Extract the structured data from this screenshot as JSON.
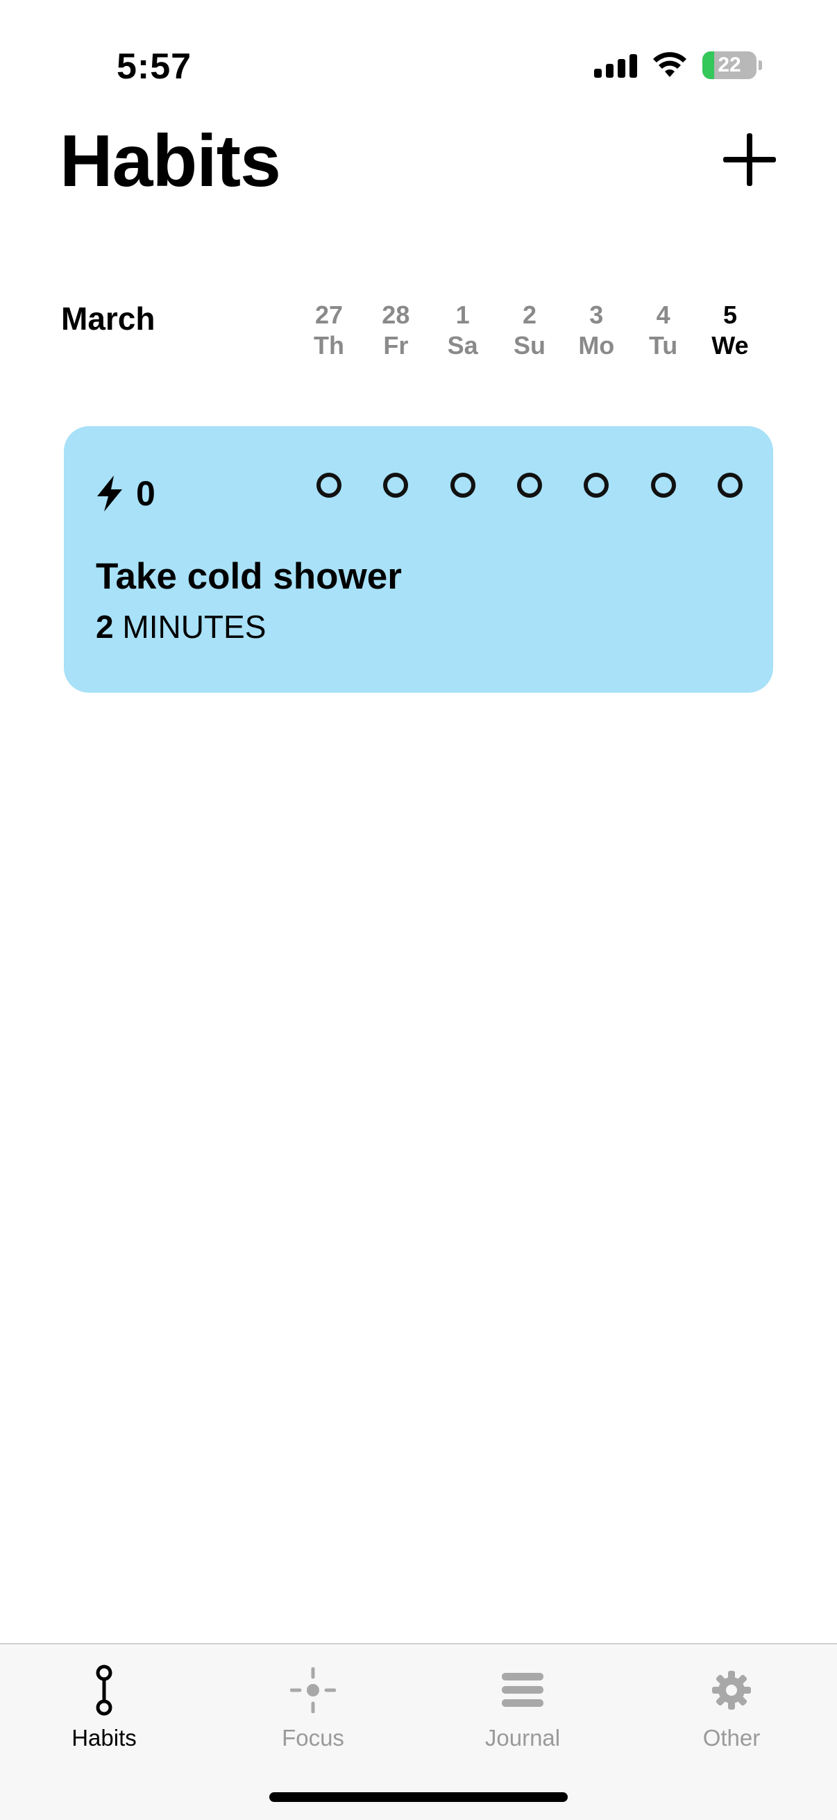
{
  "status_bar": {
    "time": "5:57",
    "battery_text": "22",
    "battery_level_percent": 22,
    "icons": [
      "cellular-signal-icon",
      "wifi-icon",
      "battery-charging-icon"
    ]
  },
  "header": {
    "title": "Habits",
    "add_icon": "plus-icon"
  },
  "calendar": {
    "month": "March",
    "days": [
      {
        "date": "27",
        "weekday": "Th",
        "today": false
      },
      {
        "date": "28",
        "weekday": "Fr",
        "today": false
      },
      {
        "date": "1",
        "weekday": "Sa",
        "today": false
      },
      {
        "date": "2",
        "weekday": "Su",
        "today": false
      },
      {
        "date": "3",
        "weekday": "Mo",
        "today": false
      },
      {
        "date": "4",
        "weekday": "Tu",
        "today": false
      },
      {
        "date": "5",
        "weekday": "We",
        "today": true
      }
    ]
  },
  "habits": [
    {
      "name": "Take cold shower",
      "streak": "0",
      "streak_icon": "lightning-bolt-icon",
      "duration_value": "2",
      "duration_unit": "MINUTES",
      "color": "#a8e1f8",
      "completions": [
        false,
        false,
        false,
        false,
        false,
        false,
        false
      ]
    }
  ],
  "tab_bar": {
    "tabs": [
      {
        "label": "Habits",
        "icon": "habits-chain-icon",
        "active": true
      },
      {
        "label": "Focus",
        "icon": "focus-crosshair-icon",
        "active": false
      },
      {
        "label": "Journal",
        "icon": "journal-lines-icon",
        "active": false
      },
      {
        "label": "Other",
        "icon": "gear-icon",
        "active": false
      }
    ]
  },
  "colors": {
    "accent_card": "#a8e1f8",
    "battery_green": "#34c759",
    "inactive_gray": "#8a8a8a"
  }
}
